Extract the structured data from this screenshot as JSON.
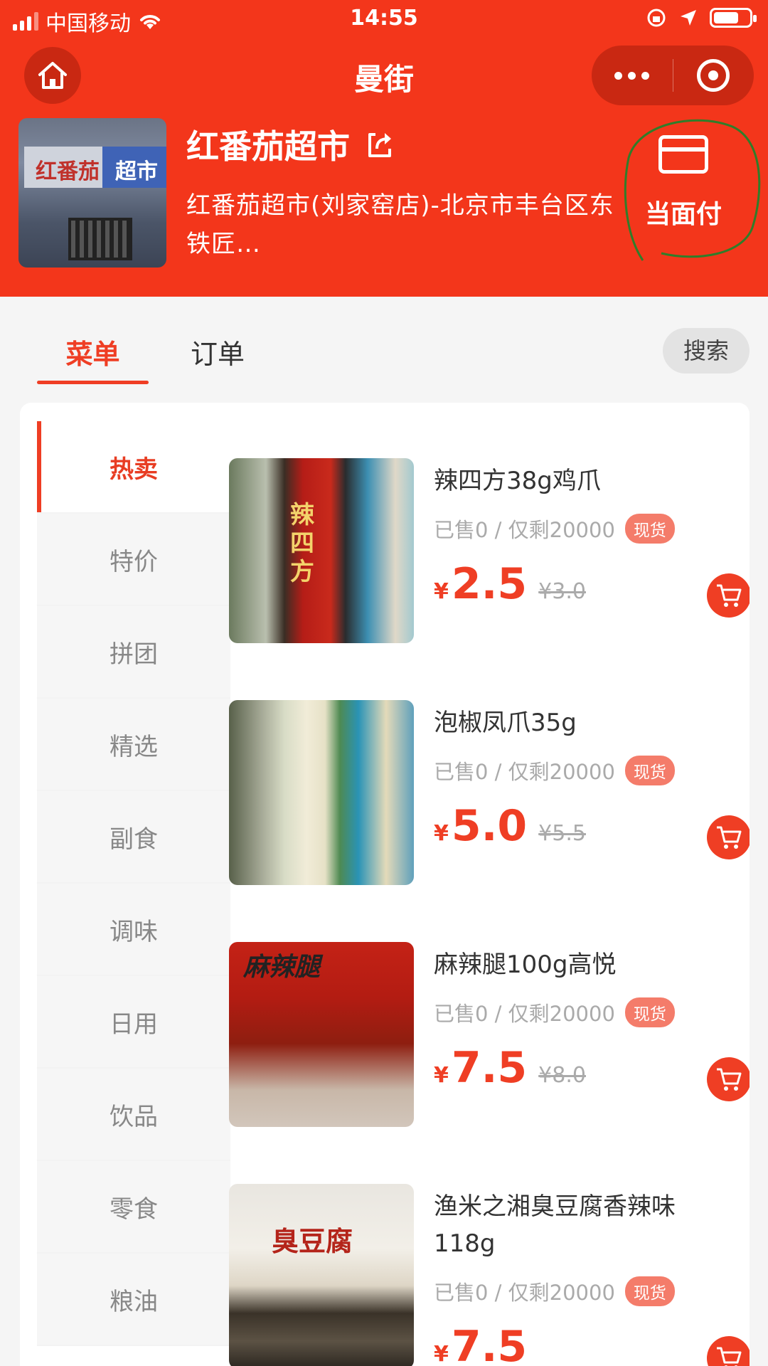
{
  "status_bar": {
    "carrier": "中国移动",
    "time": "14:55"
  },
  "nav": {
    "title": "曼街"
  },
  "store": {
    "name": "红番茄超市",
    "address": "红番茄超市(刘家窑店)-北京市丰台区东铁匠…",
    "pay_label": "当面付",
    "photo_sign_left": "红番茄",
    "photo_sign_right": "超市"
  },
  "tabs": {
    "menu": "菜单",
    "orders": "订单",
    "search": "搜索"
  },
  "categories": [
    "热卖",
    "特价",
    "拼团",
    "精选",
    "副食",
    "调味",
    "日用",
    "饮品",
    "零食",
    "粮油"
  ],
  "products": [
    {
      "name": "辣四方38g鸡爪",
      "stock": "已售0 / 仅剩20000",
      "badge": "现货",
      "currency": "¥",
      "price": "2.5",
      "old_price": "¥3.0"
    },
    {
      "name": "泡椒凤爪35g",
      "stock": "已售0 / 仅剩20000",
      "badge": "现货",
      "currency": "¥",
      "price": "5.0",
      "old_price": "¥5.5"
    },
    {
      "name": "麻辣腿100g高悦",
      "stock": "已售0 / 仅剩20000",
      "badge": "现货",
      "currency": "¥",
      "price": "7.5",
      "old_price": "¥8.0"
    },
    {
      "name": "渔米之湘臭豆腐香辣味118g",
      "stock": "已售0 / 仅剩20000",
      "badge": "现货",
      "currency": "¥",
      "price": "7.5",
      "old_price": ""
    }
  ],
  "product_image_text": [
    "辣四方",
    "",
    "麻辣腿",
    "臭豆腐"
  ],
  "colors": {
    "brand_red": "#f3361b",
    "price_red": "#ef3e24",
    "badge": "#f47c6a",
    "annotation_circle": "#2f7d2a"
  }
}
